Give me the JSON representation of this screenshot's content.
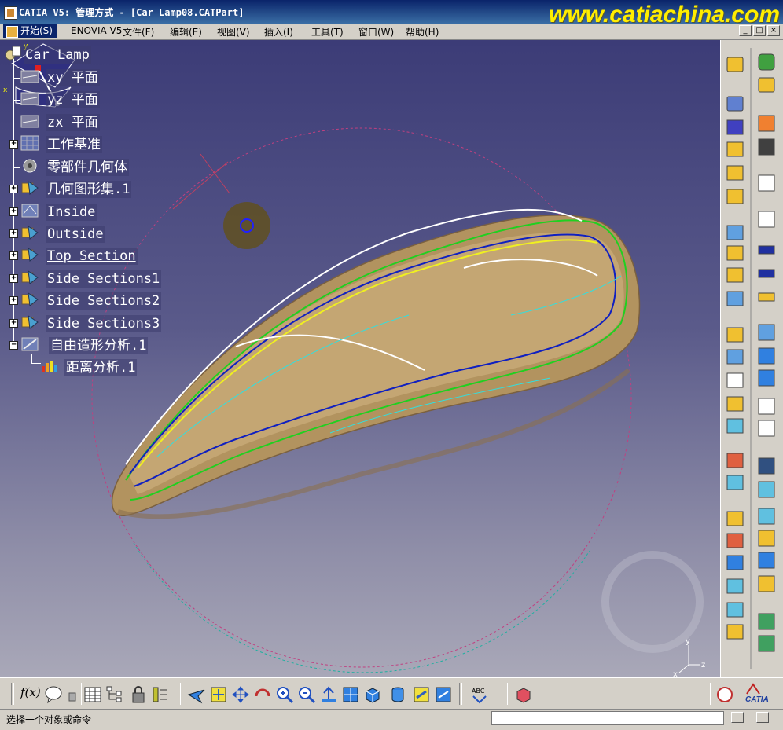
{
  "window": {
    "title": "CATIA V5: 管理方式 - [Car Lamp08.CATPart]",
    "watermark": "www.catiachina.com",
    "controls": [
      "_",
      "□",
      "×"
    ]
  },
  "menu": {
    "start": "开始(S)",
    "items": [
      "ENOVIA V5",
      "文件(F)",
      "编辑(E)",
      "视图(V)",
      "插入(I)",
      "工具(T)",
      "窗口(W)",
      "帮助(H)"
    ]
  },
  "tree": {
    "root": "Car Lamp",
    "nodes": [
      {
        "label": "xy 平面",
        "icon": "plane-icon"
      },
      {
        "label": "yz 平面",
        "icon": "plane-icon"
      },
      {
        "label": "zx 平面",
        "icon": "plane-icon"
      },
      {
        "label": "工作基准",
        "icon": "working-support-icon"
      },
      {
        "label": "零部件几何体",
        "icon": "part-body-icon"
      },
      {
        "label": "几何图形集.1",
        "icon": "geometrical-set-icon"
      },
      {
        "label": "Inside",
        "icon": "geometrical-set-icon"
      },
      {
        "label": "Outside",
        "icon": "geometrical-set-icon"
      },
      {
        "label": "Top Section",
        "icon": "geometrical-set-icon"
      },
      {
        "label": "Side Sections1",
        "icon": "geometrical-set-icon"
      },
      {
        "label": "Side Sections2",
        "icon": "geometrical-set-icon"
      },
      {
        "label": "Side Sections3",
        "icon": "geometrical-set-icon"
      },
      {
        "label": "自由造形分析.1",
        "icon": "freestyle-analysis-icon"
      }
    ],
    "child": {
      "label": "距离分析.1",
      "icon": "distance-analysis-icon"
    }
  },
  "status": {
    "message": "选择一个对象或命令"
  },
  "logo": {
    "brand": "CATIA"
  },
  "axes": {
    "x": "x",
    "y": "y",
    "z": "z"
  },
  "colors": {
    "title_bar": "#0a246a",
    "viewport_top": "#3c3c77",
    "part": "#b89a6a",
    "watermark": "#ffee00"
  }
}
